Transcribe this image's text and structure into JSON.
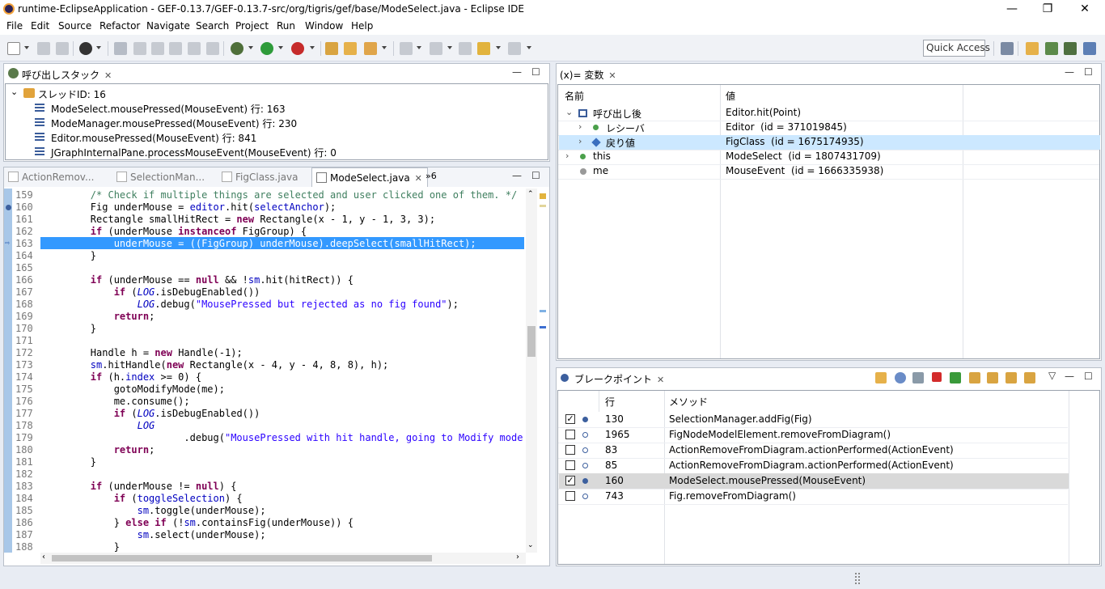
{
  "window": {
    "title": "runtime-EclipseApplication - GEF-0.13.7/GEF-0.13.7-src/org/tigris/gef/base/ModeSelect.java - Eclipse IDE",
    "min": "—",
    "restore": "❐",
    "close": "✕"
  },
  "menu": [
    "File",
    "Edit",
    "Source",
    "Refactor",
    "Navigate",
    "Search",
    "Project",
    "Run",
    "Window",
    "Help"
  ],
  "toolbar": {
    "quick_access": "Quick Access"
  },
  "callstack": {
    "tab": "呼び出しスタック",
    "thread": "スレッドID: 16",
    "frames": [
      "ModeSelect.mousePressed(MouseEvent) 行: 163",
      "ModeManager.mousePressed(MouseEvent) 行: 230",
      "Editor.mousePressed(MouseEvent) 行: 841",
      "JGraphInternalPane.processMouseEvent(MouseEvent) 行: 0"
    ]
  },
  "editor": {
    "tabs": [
      "ActionRemov...",
      "SelectionMan...",
      "FigClass.java",
      "ModeSelect.java"
    ],
    "overflow": "»6",
    "current_line": 163,
    "lines": [
      {
        "n": "159",
        "t": [
          [
            "cm",
            "        /* Check if multiple things are selected and user clicked one of them. */"
          ]
        ]
      },
      {
        "n": "160",
        "t": [
          [
            "",
            "        Fig underMouse = "
          ],
          [
            "fld",
            "editor"
          ],
          [
            "",
            ".hit("
          ],
          [
            "fld",
            "selectAnchor"
          ],
          [
            "",
            ");"
          ]
        ]
      },
      {
        "n": "161",
        "t": [
          [
            "",
            "        Rectangle smallHitRect = "
          ],
          [
            "kw",
            "new"
          ],
          [
            "",
            " Rectangle(x - 1, y - 1, 3, 3);"
          ]
        ]
      },
      {
        "n": "162",
        "t": [
          [
            "",
            "        "
          ],
          [
            "kw",
            "if"
          ],
          [
            "",
            " (underMouse "
          ],
          [
            "kw",
            "instanceof"
          ],
          [
            "",
            " FigGroup) {"
          ]
        ]
      },
      {
        "n": "163",
        "t": [
          [
            "",
            "            underMouse = ((FigGroup) underMouse).deepSelect(smallHitRect);"
          ]
        ]
      },
      {
        "n": "164",
        "t": [
          [
            "",
            "        }"
          ]
        ]
      },
      {
        "n": "165",
        "t": [
          [
            "",
            ""
          ]
        ]
      },
      {
        "n": "166",
        "t": [
          [
            "",
            "        "
          ],
          [
            "kw",
            "if"
          ],
          [
            "",
            " (underMouse == "
          ],
          [
            "kw",
            "null"
          ],
          [
            "",
            " && !"
          ],
          [
            "fld",
            "sm"
          ],
          [
            "",
            ".hit(hitRect)) {"
          ]
        ]
      },
      {
        "n": "167",
        "t": [
          [
            "",
            "            "
          ],
          [
            "kw",
            "if"
          ],
          [
            "",
            " ("
          ],
          [
            "fld ital",
            "LOG"
          ],
          [
            "",
            ".isDebugEnabled())"
          ]
        ]
      },
      {
        "n": "168",
        "t": [
          [
            "",
            "                "
          ],
          [
            "fld ital",
            "LOG"
          ],
          [
            "",
            ".debug("
          ],
          [
            "str",
            "\"MousePressed but rejected as no fig found\""
          ],
          [
            "",
            ");"
          ]
        ]
      },
      {
        "n": "169",
        "t": [
          [
            "",
            "            "
          ],
          [
            "kw",
            "return"
          ],
          [
            "",
            ";"
          ]
        ]
      },
      {
        "n": "170",
        "t": [
          [
            "",
            "        }"
          ]
        ]
      },
      {
        "n": "171",
        "t": [
          [
            "",
            ""
          ]
        ]
      },
      {
        "n": "172",
        "t": [
          [
            "",
            "        Handle h = "
          ],
          [
            "kw",
            "new"
          ],
          [
            "",
            " Handle(-1);"
          ]
        ]
      },
      {
        "n": "173",
        "t": [
          [
            "",
            "        "
          ],
          [
            "fld",
            "sm"
          ],
          [
            "",
            ".hitHandle("
          ],
          [
            "kw",
            "new"
          ],
          [
            "",
            " Rectangle(x - 4, y - 4, 8, 8), h);"
          ]
        ]
      },
      {
        "n": "174",
        "t": [
          [
            "",
            "        "
          ],
          [
            "kw",
            "if"
          ],
          [
            "",
            " (h."
          ],
          [
            "fld",
            "index"
          ],
          [
            "",
            " >= 0) {"
          ]
        ]
      },
      {
        "n": "175",
        "t": [
          [
            "",
            "            gotoModifyMode(me);"
          ]
        ]
      },
      {
        "n": "176",
        "t": [
          [
            "",
            "            me.consume();"
          ]
        ]
      },
      {
        "n": "177",
        "t": [
          [
            "",
            "            "
          ],
          [
            "kw",
            "if"
          ],
          [
            "",
            " ("
          ],
          [
            "fld ital",
            "LOG"
          ],
          [
            "",
            ".isDebugEnabled())"
          ]
        ]
      },
      {
        "n": "178",
        "t": [
          [
            "",
            "                "
          ],
          [
            "fld ital",
            "LOG"
          ]
        ]
      },
      {
        "n": "179",
        "t": [
          [
            "",
            "                        .debug("
          ],
          [
            "str",
            "\"MousePressed with hit handle, going to Modify mode and"
          ]
        ]
      },
      {
        "n": "180",
        "t": [
          [
            "",
            "            "
          ],
          [
            "kw",
            "return"
          ],
          [
            "",
            ";"
          ]
        ]
      },
      {
        "n": "181",
        "t": [
          [
            "",
            "        }"
          ]
        ]
      },
      {
        "n": "182",
        "t": [
          [
            "",
            ""
          ]
        ]
      },
      {
        "n": "183",
        "t": [
          [
            "",
            "        "
          ],
          [
            "kw",
            "if"
          ],
          [
            "",
            " (underMouse != "
          ],
          [
            "kw",
            "null"
          ],
          [
            "",
            ") {"
          ]
        ]
      },
      {
        "n": "184",
        "t": [
          [
            "",
            "            "
          ],
          [
            "kw",
            "if"
          ],
          [
            "",
            " ("
          ],
          [
            "fld",
            "toggleSelection"
          ],
          [
            "",
            ") {"
          ]
        ]
      },
      {
        "n": "185",
        "t": [
          [
            "",
            "                "
          ],
          [
            "fld",
            "sm"
          ],
          [
            "",
            ".toggle(underMouse);"
          ]
        ]
      },
      {
        "n": "186",
        "t": [
          [
            "",
            "            } "
          ],
          [
            "kw",
            "else"
          ],
          [
            "",
            " "
          ],
          [
            "kw",
            "if"
          ],
          [
            "",
            " (!"
          ],
          [
            "fld",
            "sm"
          ],
          [
            "",
            ".containsFig(underMouse)) {"
          ]
        ]
      },
      {
        "n": "187",
        "t": [
          [
            "",
            "                "
          ],
          [
            "fld",
            "sm"
          ],
          [
            "",
            ".select(underMouse);"
          ]
        ]
      },
      {
        "n": "188",
        "t": [
          [
            "",
            "            }"
          ]
        ]
      }
    ]
  },
  "variables": {
    "tab": "(x)= 変数",
    "col_name": "名前",
    "col_value": "値",
    "rows": [
      {
        "name": "呼び出し後",
        "value": "Editor.hit(Point)",
        "indent": 0,
        "expander": "⌄",
        "selected": false
      },
      {
        "name": "レシーバ",
        "value": "Editor  (id = 371019845)",
        "indent": 1,
        "expander": "›",
        "selected": false
      },
      {
        "name": "戻り値",
        "value": "FigClass  (id = 1675174935)",
        "indent": 1,
        "expander": "›",
        "selected": true
      },
      {
        "name": "this",
        "value": "ModeSelect  (id = 1807431709)",
        "indent": 0,
        "expander": "›",
        "selected": false
      },
      {
        "name": "me",
        "value": "MouseEvent  (id = 1666335938)",
        "indent": 0,
        "expander": "",
        "selected": false
      }
    ]
  },
  "breakpoints": {
    "tab": "ブレークポイント",
    "col_line": "行",
    "col_method": "メソッド",
    "rows": [
      {
        "checked": true,
        "line": "130",
        "method": "SelectionManager.addFig(Fig)",
        "selected": false
      },
      {
        "checked": false,
        "line": "1965",
        "method": "FigNodeModelElement.removeFromDiagram()",
        "selected": false
      },
      {
        "checked": false,
        "line": "83",
        "method": "ActionRemoveFromDiagram.actionPerformed(ActionEvent)",
        "selected": false
      },
      {
        "checked": false,
        "line": "85",
        "method": "ActionRemoveFromDiagram.actionPerformed(ActionEvent)",
        "selected": false
      },
      {
        "checked": true,
        "line": "160",
        "method": "ModeSelect.mousePressed(MouseEvent)",
        "selected": true
      },
      {
        "checked": false,
        "line": "743",
        "method": "Fig.removeFromDiagram()",
        "selected": false
      }
    ]
  },
  "colors": {
    "highlight": "#3399ff",
    "selection": "#cce8ff",
    "gray_selection": "#d9d9d9"
  }
}
